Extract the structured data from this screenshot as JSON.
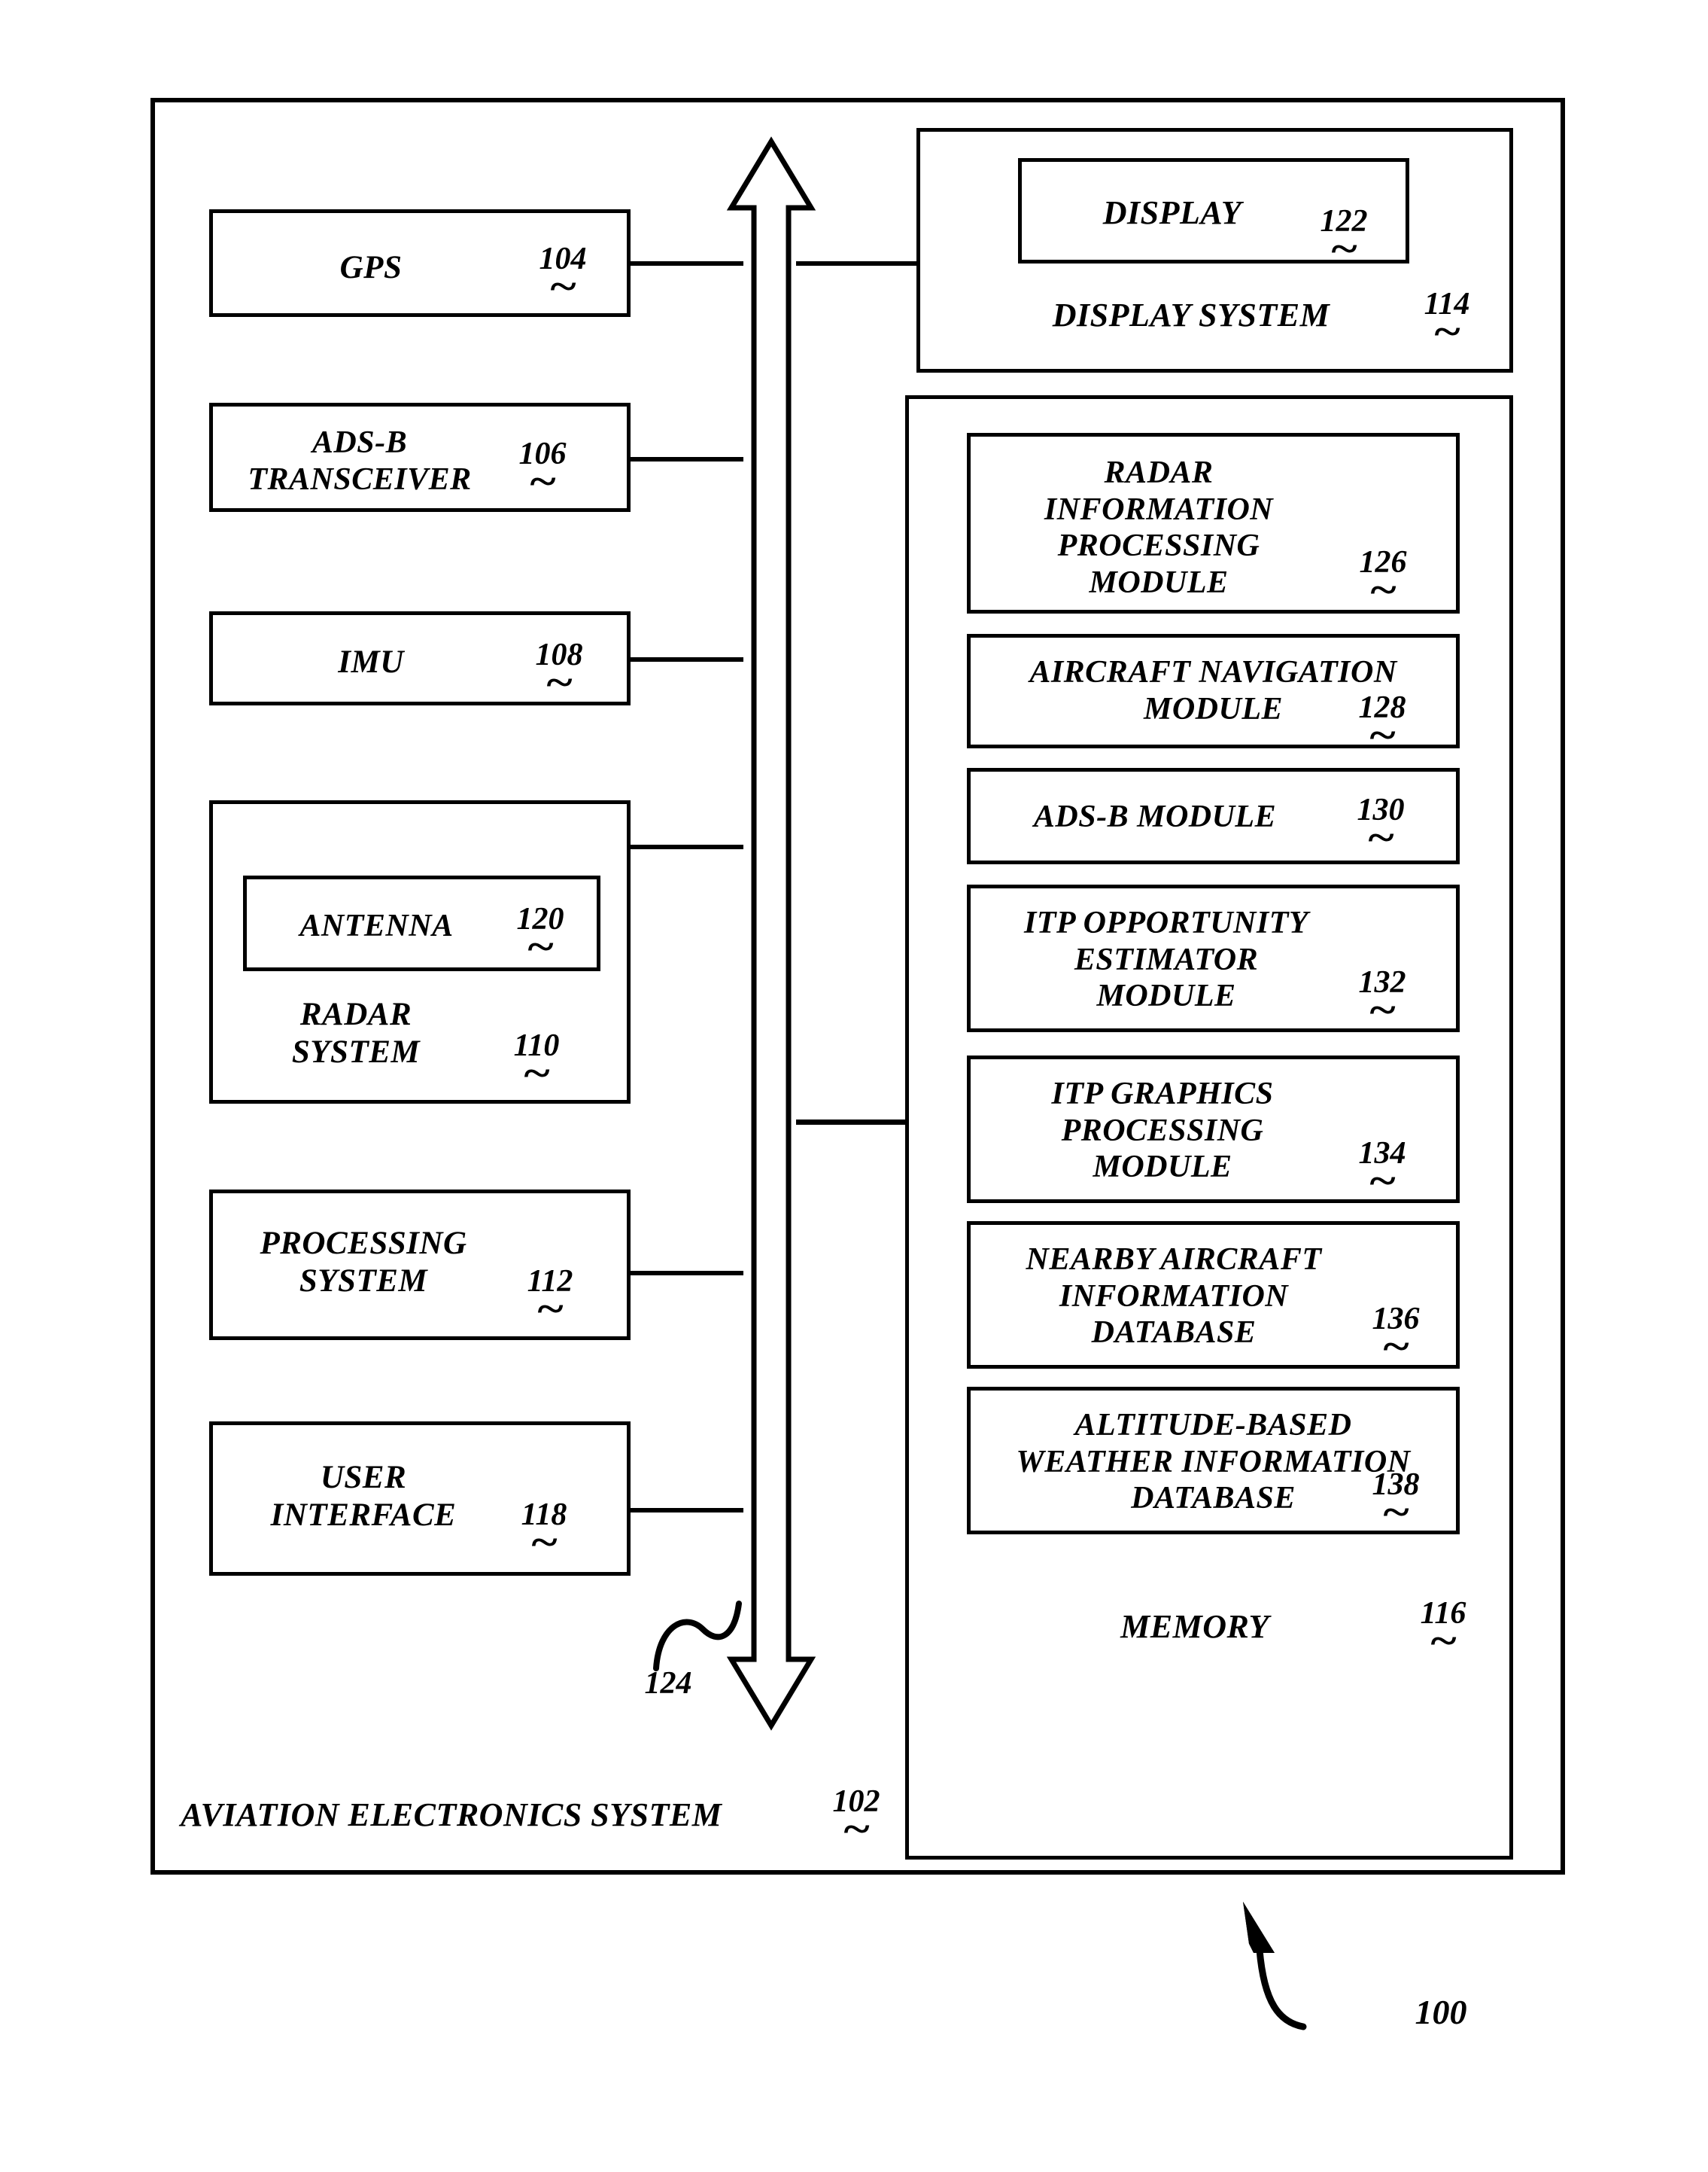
{
  "figure": {
    "overall_ref": "100",
    "outer_container": {
      "label": "AVIATION ELECTRONICS SYSTEM",
      "ref": "102"
    }
  },
  "left_column": [
    {
      "name": "gps",
      "label": "GPS",
      "ref": "104"
    },
    {
      "name": "adsb",
      "label": "ADS-B\nTRANSCEIVER",
      "ref": "106"
    },
    {
      "name": "imu",
      "label": "IMU",
      "ref": "108"
    },
    {
      "name": "radar-system",
      "label": "RADAR\nSYSTEM",
      "ref": "110",
      "child": {
        "name": "antenna",
        "label": "ANTENNA",
        "ref": "120"
      }
    },
    {
      "name": "processing",
      "label": "PROCESSING\nSYSTEM",
      "ref": "112"
    },
    {
      "name": "user-interface",
      "label": "USER\nINTERFACE",
      "ref": "118"
    }
  ],
  "bus": {
    "label": "",
    "ref": "124"
  },
  "display_system": {
    "label": "DISPLAY SYSTEM",
    "ref": "114",
    "child": {
      "label": "DISPLAY",
      "ref": "122"
    }
  },
  "memory": {
    "label": "MEMORY",
    "ref": "116",
    "modules": [
      {
        "name": "radar-information-processing-module",
        "label": "RADAR\nINFORMATION\nPROCESSING\nMODULE",
        "ref": "126"
      },
      {
        "name": "aircraft-navigation-module",
        "label": "AIRCRAFT NAVIGATION\nMODULE",
        "ref": "128"
      },
      {
        "name": "adsb-module",
        "label": "ADS-B MODULE",
        "ref": "130"
      },
      {
        "name": "itp-opportunity-estimator-module",
        "label": "ITP OPPORTUNITY\nESTIMATOR\nMODULE",
        "ref": "132"
      },
      {
        "name": "itp-graphics-processing-module",
        "label": "ITP GRAPHICS\nPROCESSING\nMODULE",
        "ref": "134"
      },
      {
        "name": "nearby-aircraft-information-database",
        "label": "NEARBY AIRCRAFT\nINFORMATION\nDATABASE",
        "ref": "136"
      },
      {
        "name": "altitude-based-weather-information-database",
        "label": "ALTITUDE-BASED\nWEATHER INFORMATION\nDATABASE",
        "ref": "138"
      }
    ]
  }
}
